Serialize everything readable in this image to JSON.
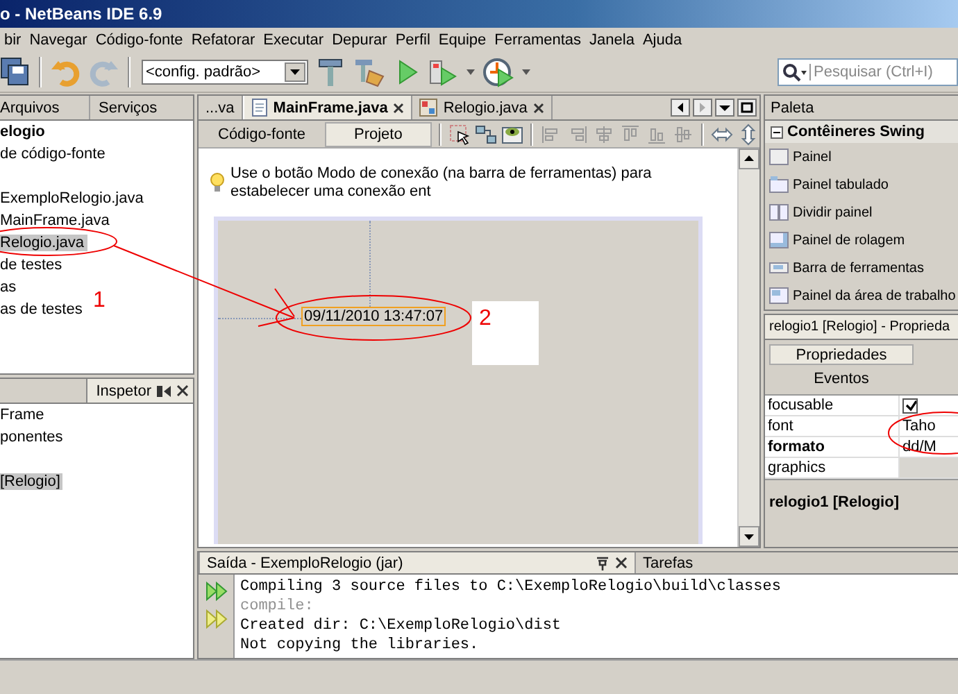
{
  "window": {
    "title": "o - NetBeans IDE 6.9"
  },
  "menu": [
    "bir",
    "Navegar",
    "Código-fonte",
    "Refatorar",
    "Executar",
    "Depurar",
    "Perfil",
    "Equipe",
    "Ferramentas",
    "Janela",
    "Ajuda"
  ],
  "toolbar": {
    "configuration": "<config. padrão>",
    "search": {
      "placeholder": "Pesquisar (Ctrl+I)"
    }
  },
  "projects_panel": {
    "tabs": [
      {
        "label": "Arquivos",
        "selected": false
      },
      {
        "label": "Serviços",
        "selected": false
      }
    ],
    "tree": [
      {
        "label": "elogio",
        "selected": false,
        "children": [
          {
            "label": "de código-fonte",
            "selected": false,
            "children": [
              {
                "label": "ExemploRelogio.java",
                "selected": false
              },
              {
                "label": "MainFrame.java",
                "selected": false
              },
              {
                "label": "Relogio.java",
                "selected": true
              }
            ]
          },
          {
            "label": "de testes",
            "selected": false
          },
          {
            "label": "as",
            "selected": false
          },
          {
            "label": "as de testes",
            "selected": false
          }
        ]
      }
    ]
  },
  "inspector_panel": {
    "title": "Inspetor",
    "tree": [
      {
        "label": "Frame",
        "selected": false,
        "children": [
          {
            "label": "ponentes",
            "selected": false,
            "children": [
              {
                "label": "[Relogio]",
                "selected": true
              }
            ]
          }
        ]
      }
    ]
  },
  "editor": {
    "tabs": [
      {
        "label": "...va",
        "selected": false,
        "closable": false
      },
      {
        "label": "MainFrame.java",
        "selected": true,
        "closable": true
      },
      {
        "label": "Relogio.java",
        "selected": false,
        "closable": true
      }
    ],
    "views": [
      {
        "label": "Código-fonte",
        "selected": false
      },
      {
        "label": "Projeto",
        "selected": true
      }
    ],
    "hint": "Use o botão Modo de conexão (na barra de ferramentas) para estabelecer uma conexão ent",
    "form": {
      "clock_label": "09/11/2010 13:47:07",
      "selected": true
    }
  },
  "palette": {
    "title": "Paleta",
    "category": {
      "label": "Contêineres Swing",
      "expanded": true
    },
    "items": [
      "Painel",
      "Painel tabulado",
      "Dividir painel",
      "Painel de rolagem",
      "Barra de ferramentas",
      "Painel da área de trabalho"
    ]
  },
  "properties": {
    "title": "relogio1 [Relogio] - Proprieda",
    "tabs": [
      {
        "label": "Propriedades",
        "selected": true
      },
      {
        "label": "Eventos",
        "selected": false
      }
    ],
    "rows": [
      {
        "name": "focusable",
        "kind": "checkbox",
        "checked": true,
        "modified": false
      },
      {
        "name": "font",
        "kind": "text",
        "value": "Taho",
        "modified": false
      },
      {
        "name": "formato",
        "kind": "text",
        "value": "dd/M",
        "modified": true
      },
      {
        "name": "graphics",
        "kind": "text",
        "disabled": true,
        "modified": false
      }
    ],
    "footer": "relogio1 [Relogio]"
  },
  "output": {
    "tabs": [
      {
        "label": "Saída - ExemploRelogio (jar)",
        "selected": true
      },
      {
        "label": "Tarefas",
        "selected": false
      }
    ],
    "lines": [
      {
        "text": "Compiling 3 source files to C:\\ExemploRelogio\\build\\classes",
        "kind": "message"
      },
      {
        "text": "compile:",
        "kind": "target"
      },
      {
        "text": "Created dir: C:\\ExemploRelogio\\dist",
        "kind": "message"
      },
      {
        "text": "Not copying the libraries.",
        "kind": "message"
      }
    ]
  },
  "annotations": [
    {
      "label": "1"
    },
    {
      "label": "2"
    }
  ]
}
